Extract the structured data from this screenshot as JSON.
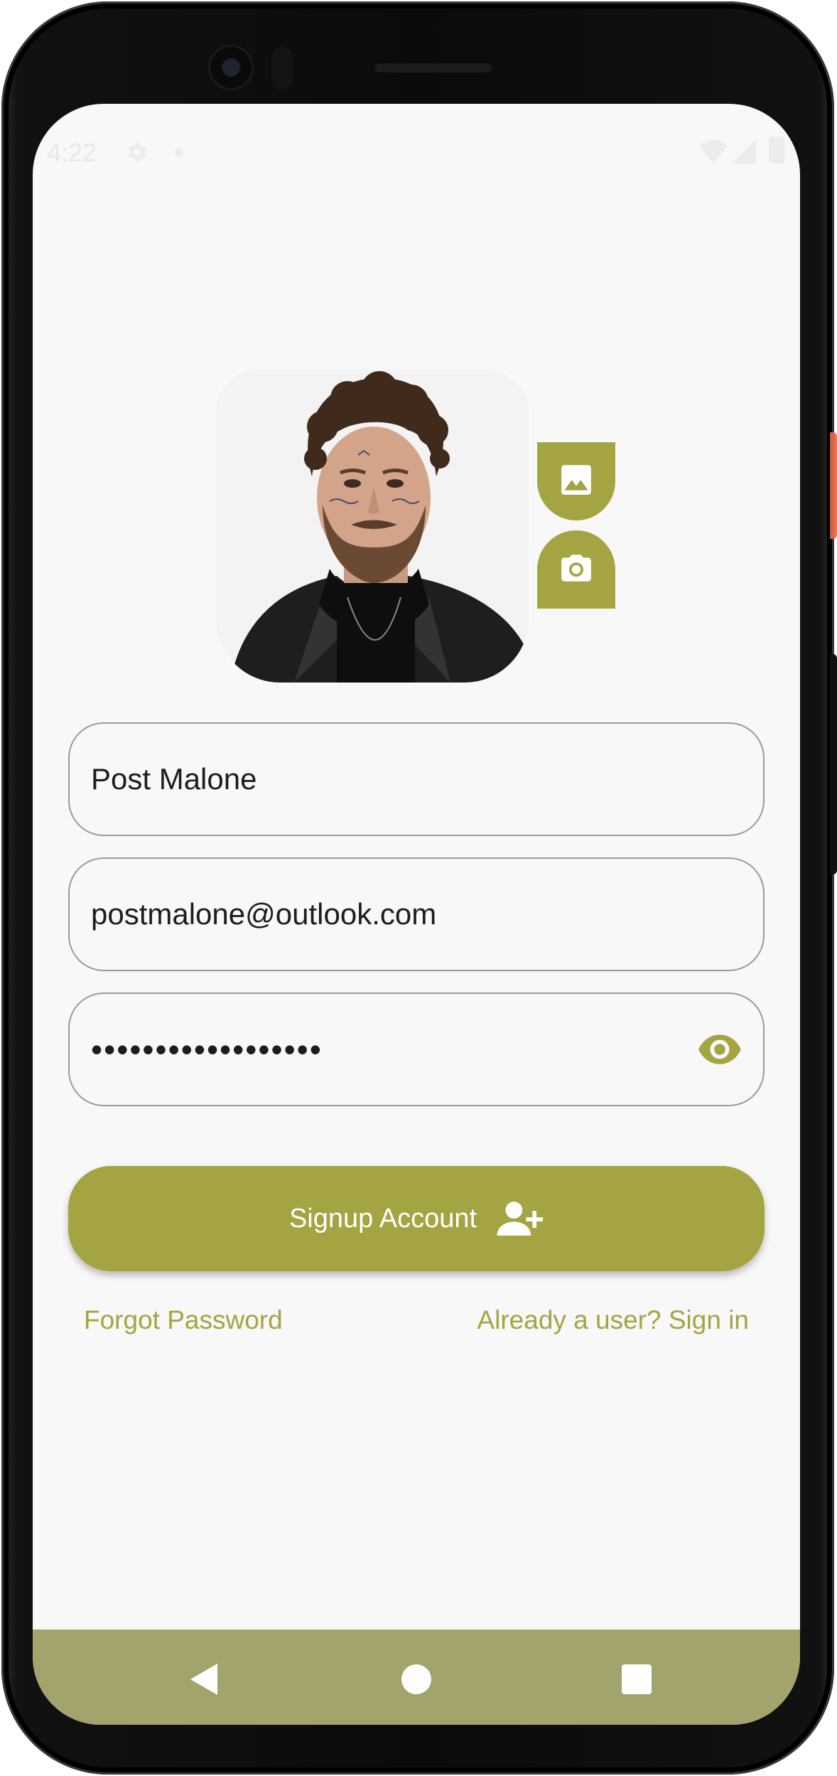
{
  "status_bar": {
    "time": "4:22",
    "icons": [
      "gear-icon",
      "dot-icon",
      "wifi-icon",
      "signal-icon",
      "battery-icon"
    ]
  },
  "avatar": {
    "description_icon": "profile-photo",
    "gallery_button_icon": "image-icon",
    "camera_button_icon": "camera-icon"
  },
  "form": {
    "name_value": "Post Malone",
    "email_value": "postmalone@outlook.com",
    "password_value": "••••••••••••••••••",
    "password_toggle_icon": "eye-icon"
  },
  "signup_button": {
    "label": "Signup Account",
    "icon": "person-add-icon"
  },
  "links": {
    "forgot_password": "Forgot Password",
    "sign_in": "Already a user? Sign in"
  },
  "nav_bar": {
    "icons": [
      "back-icon",
      "home-icon",
      "recents-icon"
    ]
  },
  "colors": {
    "accent": "#a4a442",
    "nav_bar": "#a3a36e",
    "background": "#f8f8f8",
    "field_border": "#9a9a9a"
  }
}
